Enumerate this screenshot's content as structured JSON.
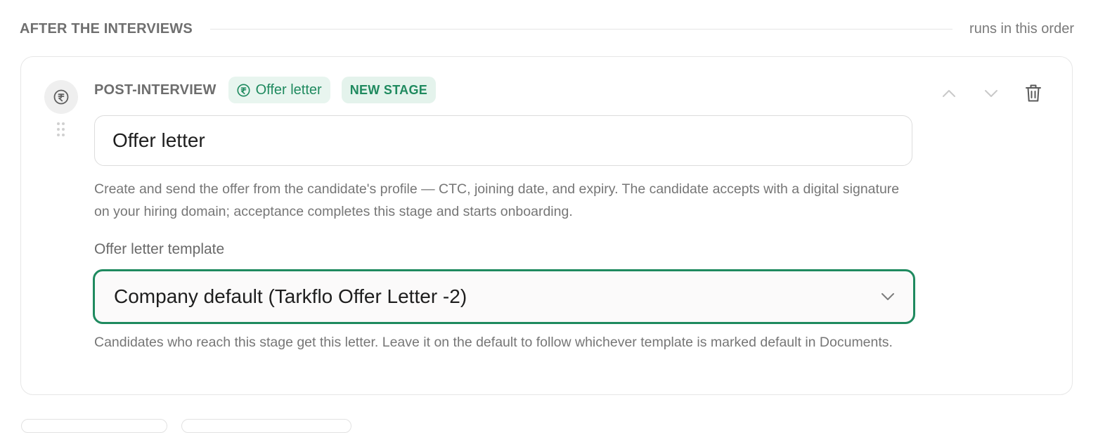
{
  "section": {
    "title": "AFTER THE INTERVIEWS",
    "order_note": "runs in this order"
  },
  "stage": {
    "icon": "rupee-icon",
    "kind_label": "POST-INTERVIEW",
    "type_chip": {
      "icon": "rupee-icon",
      "label": "Offer letter"
    },
    "new_badge": "NEW STAGE",
    "name_value": "Offer letter",
    "description": "Create and send the offer from the candidate's profile — CTC, joining date, and expiry. The candidate accepts with a digital signature on your hiring domain; acceptance completes this stage and starts onboarding.",
    "template_field": {
      "label": "Offer letter template",
      "selected": "Company default (Tarkflo Offer Letter -2)",
      "help": "Candidates who reach this stage get this letter. Leave it on the default to follow whichever template is marked default in Documents."
    },
    "actions": {
      "move_up_icon": "chevron-up-icon",
      "move_down_icon": "chevron-down-icon",
      "delete_icon": "trash-icon"
    }
  },
  "colors": {
    "accent": "#1f8a5f",
    "chip_bg": "#e8f5ef",
    "muted_text": "#767676",
    "border": "#e7e7e7"
  }
}
